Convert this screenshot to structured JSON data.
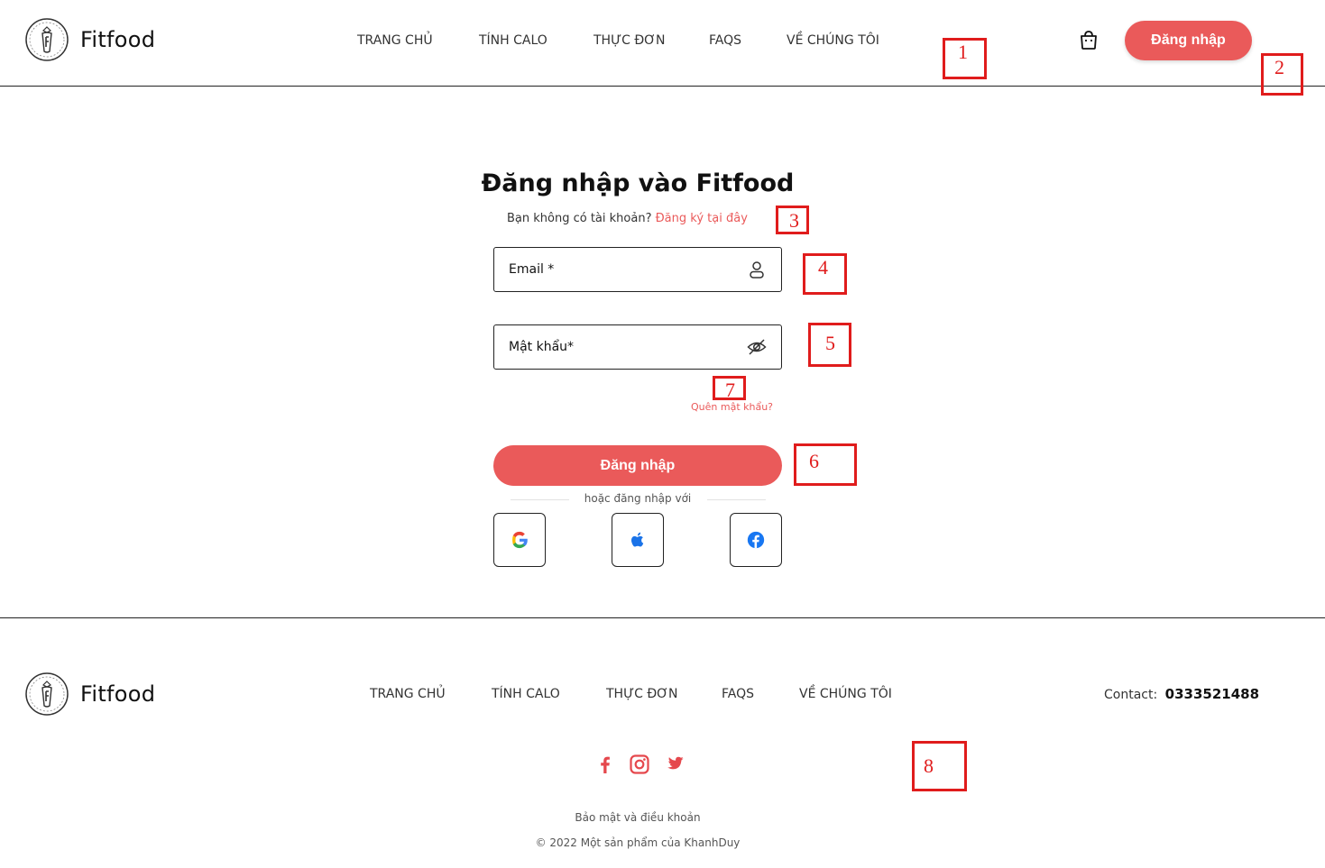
{
  "header": {
    "brand": "Fitfood",
    "nav": [
      "TRANG CHỦ",
      "TÍNH CALO",
      "THỰC ĐƠN",
      "FAQS",
      "VỀ CHÚNG TÔI"
    ],
    "login_label": "Đăng nhập"
  },
  "form": {
    "title": "Đăng nhập vào Fitfood",
    "no_account": "Bạn không có tài khoản?",
    "signup_link": "Đăng ký tại đây",
    "email_label": "Email *",
    "password_label": "Mật khẩu*",
    "forgot": "Quên mật khẩu?",
    "submit": "Đăng nhập",
    "or_text": "hoặc đăng nhập với"
  },
  "footer": {
    "brand": "Fitfood",
    "nav": [
      "TRANG CHỦ",
      "TÍNH CALO",
      "THỰC ĐƠN",
      "FAQS",
      "VỀ CHÚNG TÔI"
    ],
    "contact_label": "Contact:",
    "contact_phone": "0333521488",
    "privacy": "Bảo mật và điều khoản",
    "copyright": "© 2022 Một sản phẩm của KhanhDuy"
  },
  "annotations": [
    "1",
    "2",
    "3",
    "4",
    "5",
    "6",
    "7",
    "8"
  ],
  "colors": {
    "accent": "#ea5a5a",
    "annotation": "#e01c1c"
  }
}
